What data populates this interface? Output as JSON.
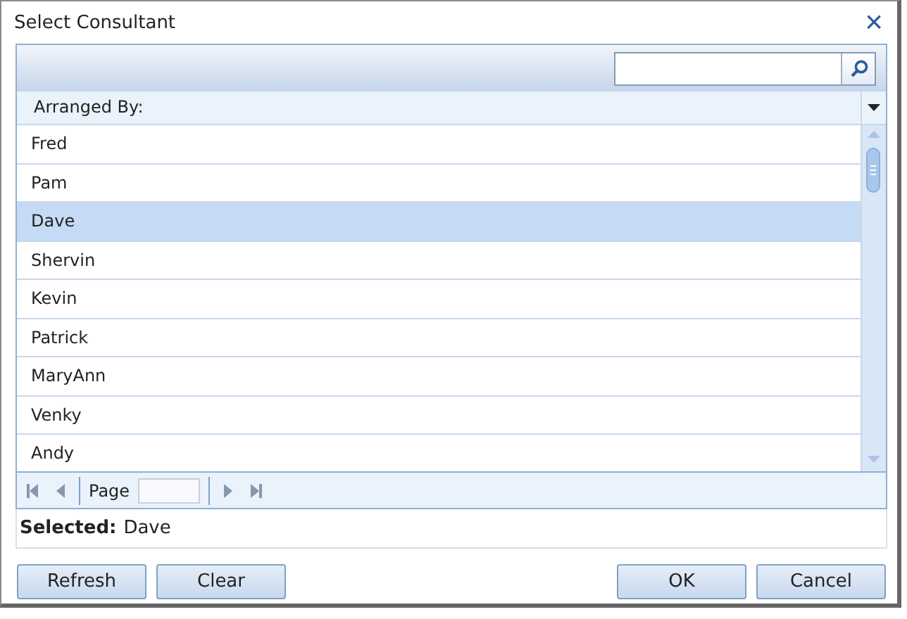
{
  "window": {
    "title": "Select Consultant",
    "close": "×"
  },
  "header": {
    "label": "Arranged By:"
  },
  "rows": [
    {
      "name": "Fred",
      "selected": false
    },
    {
      "name": "Pam",
      "selected": false
    },
    {
      "name": "Dave",
      "selected": true
    },
    {
      "name": "Shervin",
      "selected": false
    },
    {
      "name": "Kevin",
      "selected": false
    },
    {
      "name": "Patrick",
      "selected": false
    },
    {
      "name": "MaryAnn",
      "selected": false
    },
    {
      "name": "Venky",
      "selected": false
    },
    {
      "name": "Andy",
      "selected": false
    }
  ],
  "pager": {
    "label": "Page"
  },
  "selection": {
    "label": "Selected:",
    "value": "Dave"
  },
  "buttons_left": [
    "Refresh",
    "Clear"
  ],
  "buttons_right": [
    "OK",
    "Cancel"
  ]
}
